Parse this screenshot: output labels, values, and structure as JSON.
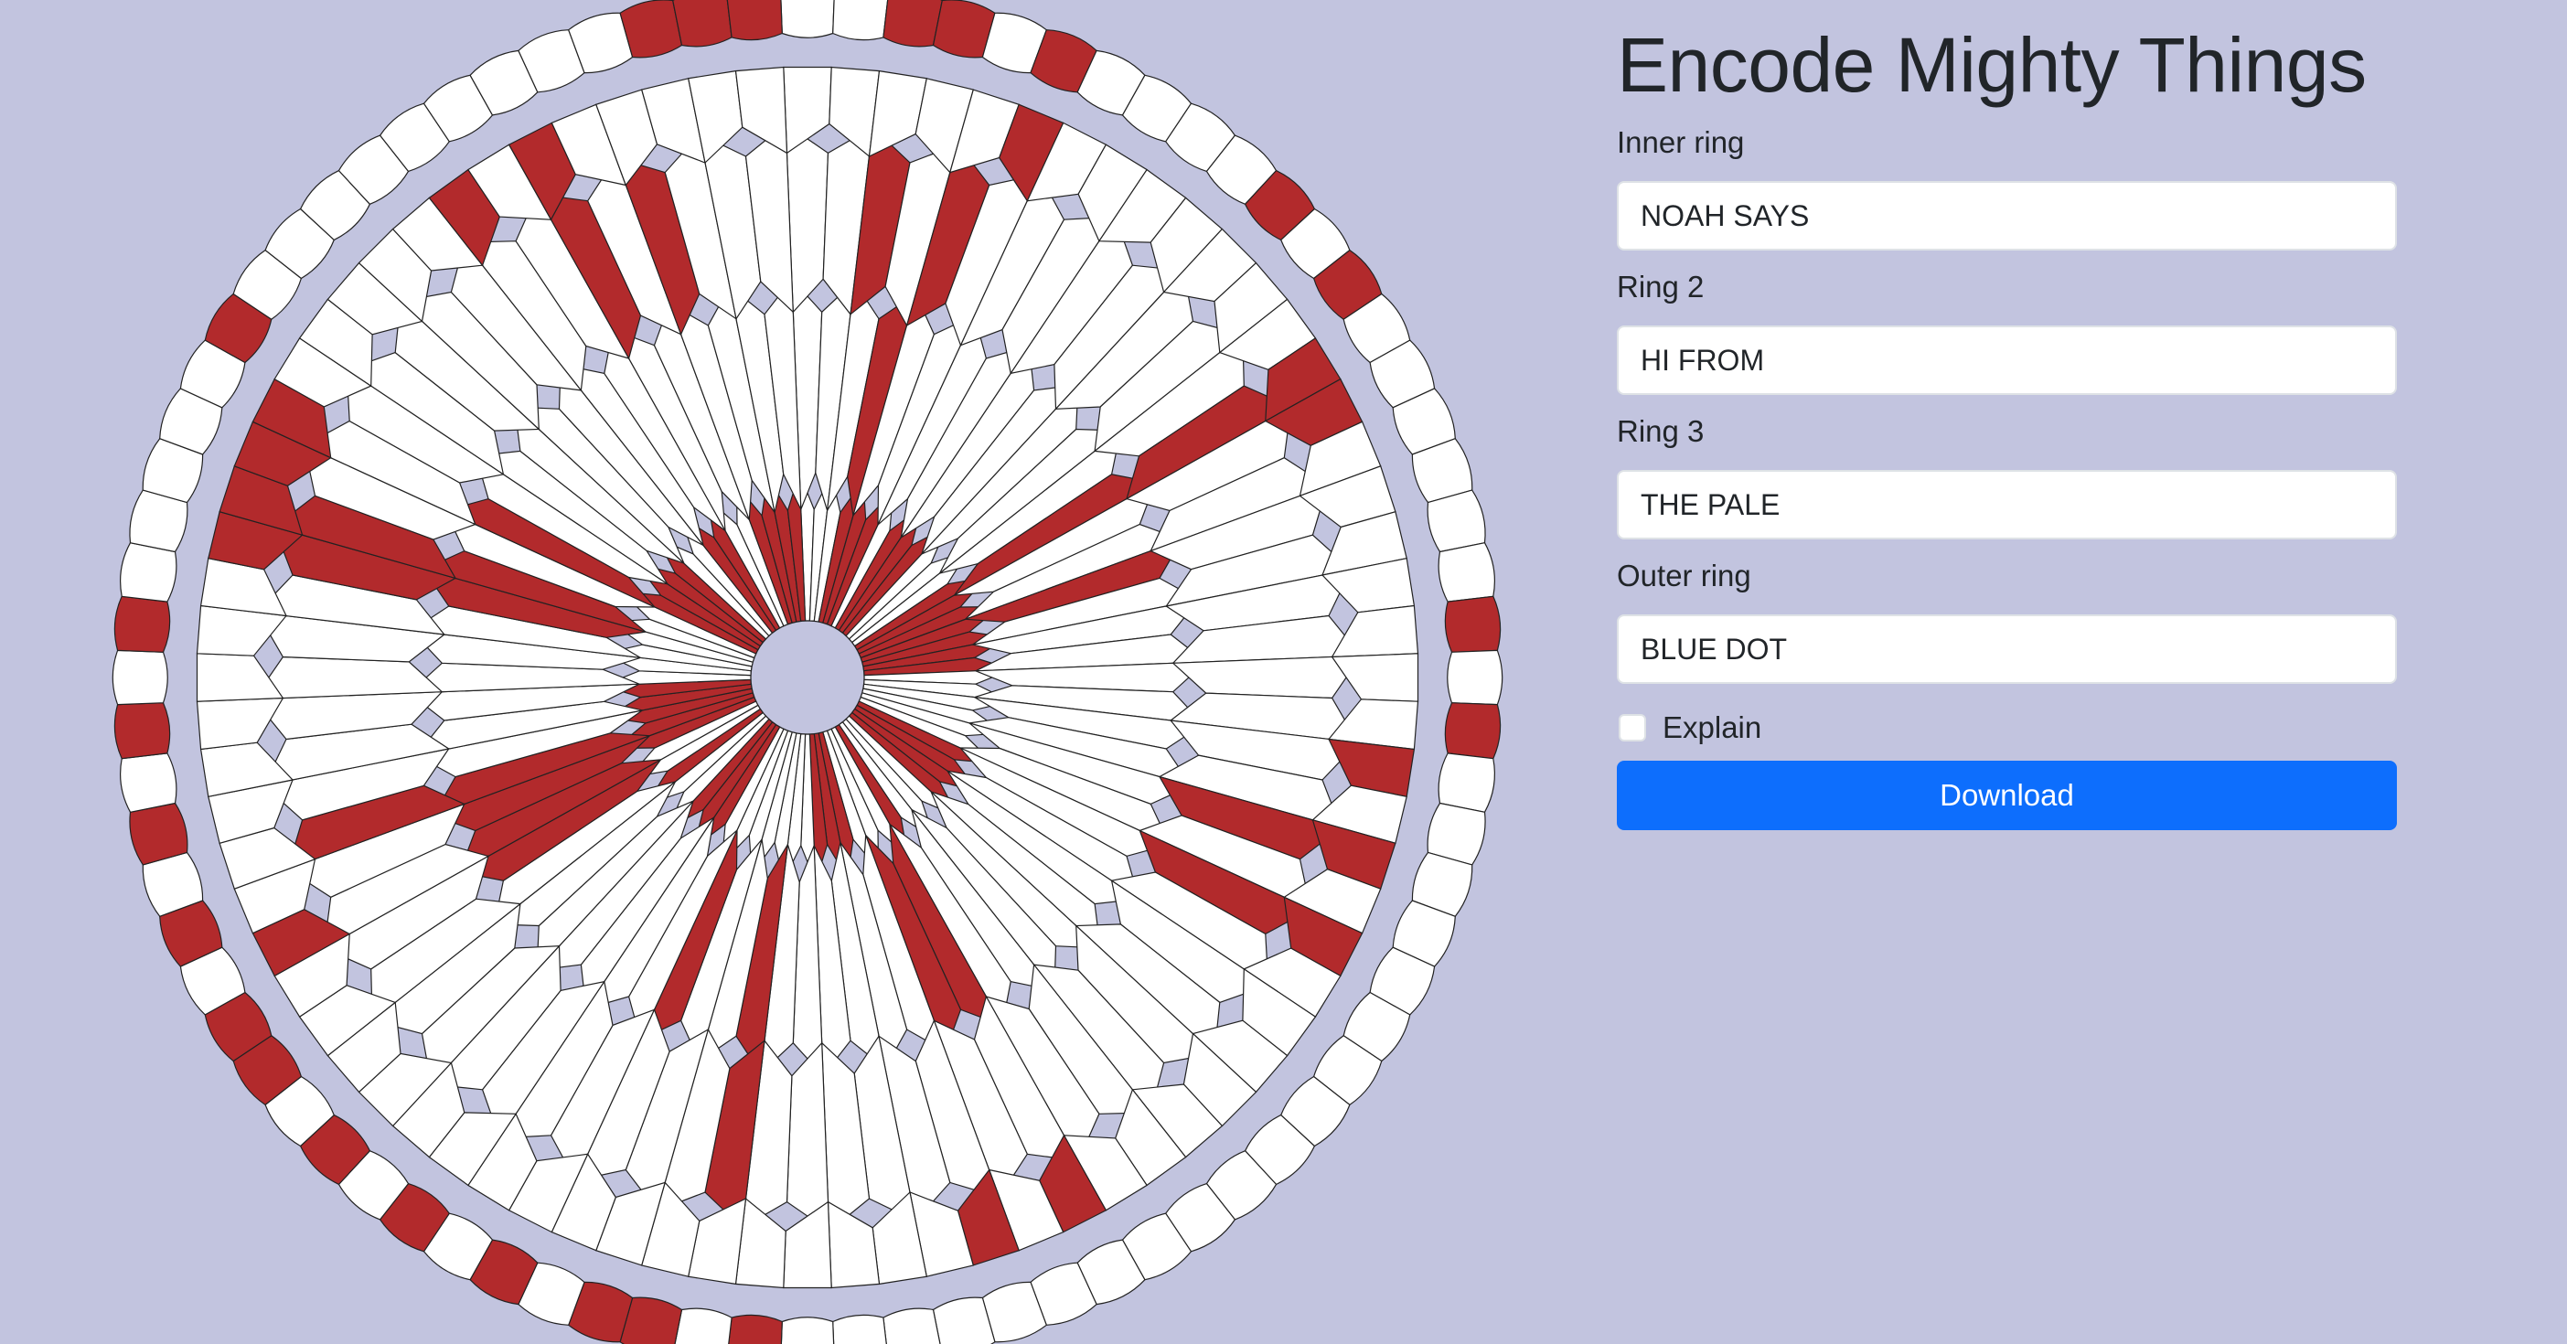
{
  "app": {
    "title": "Encode Mighty Things"
  },
  "colors": {
    "background": "#c2c4df",
    "red": "#b22a2c",
    "white": "#ffffff",
    "stroke": "#222222",
    "primary": "#0d6efd"
  },
  "form": {
    "inner_ring": {
      "label": "Inner ring",
      "value": "NOAH SAYS"
    },
    "ring2": {
      "label": "Ring 2",
      "value": "HI FROM"
    },
    "ring3": {
      "label": "Ring 3",
      "value": "THE PALE"
    },
    "outer_ring": {
      "label": "Outer ring",
      "value": "BLUE DOT"
    },
    "explain": {
      "label": "Explain",
      "checked": false
    },
    "download_label": "Download"
  },
  "parachute": {
    "gores": 80,
    "rings": [
      {
        "name": "inner",
        "text": "NOAH SAYS"
      },
      {
        "name": "ring2",
        "text": "HI FROM"
      },
      {
        "name": "ring3",
        "text": "THE PALE"
      },
      {
        "name": "outer",
        "text": "BLUE DOT"
      }
    ]
  }
}
